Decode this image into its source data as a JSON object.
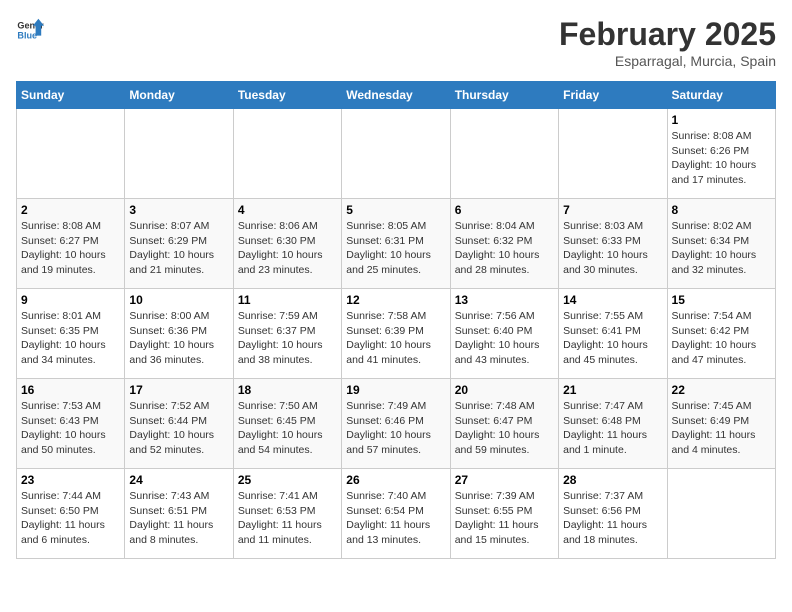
{
  "header": {
    "logo_general": "General",
    "logo_blue": "Blue",
    "title": "February 2025",
    "subtitle": "Esparragal, Murcia, Spain"
  },
  "weekdays": [
    "Sunday",
    "Monday",
    "Tuesday",
    "Wednesday",
    "Thursday",
    "Friday",
    "Saturday"
  ],
  "weeks": [
    [
      {
        "day": "",
        "content": ""
      },
      {
        "day": "",
        "content": ""
      },
      {
        "day": "",
        "content": ""
      },
      {
        "day": "",
        "content": ""
      },
      {
        "day": "",
        "content": ""
      },
      {
        "day": "",
        "content": ""
      },
      {
        "day": "1",
        "content": "Sunrise: 8:08 AM\nSunset: 6:26 PM\nDaylight: 10 hours and 17 minutes."
      }
    ],
    [
      {
        "day": "2",
        "content": "Sunrise: 8:08 AM\nSunset: 6:27 PM\nDaylight: 10 hours and 19 minutes."
      },
      {
        "day": "3",
        "content": "Sunrise: 8:07 AM\nSunset: 6:29 PM\nDaylight: 10 hours and 21 minutes."
      },
      {
        "day": "4",
        "content": "Sunrise: 8:06 AM\nSunset: 6:30 PM\nDaylight: 10 hours and 23 minutes."
      },
      {
        "day": "5",
        "content": "Sunrise: 8:05 AM\nSunset: 6:31 PM\nDaylight: 10 hours and 25 minutes."
      },
      {
        "day": "6",
        "content": "Sunrise: 8:04 AM\nSunset: 6:32 PM\nDaylight: 10 hours and 28 minutes."
      },
      {
        "day": "7",
        "content": "Sunrise: 8:03 AM\nSunset: 6:33 PM\nDaylight: 10 hours and 30 minutes."
      },
      {
        "day": "8",
        "content": "Sunrise: 8:02 AM\nSunset: 6:34 PM\nDaylight: 10 hours and 32 minutes."
      }
    ],
    [
      {
        "day": "9",
        "content": "Sunrise: 8:01 AM\nSunset: 6:35 PM\nDaylight: 10 hours and 34 minutes."
      },
      {
        "day": "10",
        "content": "Sunrise: 8:00 AM\nSunset: 6:36 PM\nDaylight: 10 hours and 36 minutes."
      },
      {
        "day": "11",
        "content": "Sunrise: 7:59 AM\nSunset: 6:37 PM\nDaylight: 10 hours and 38 minutes."
      },
      {
        "day": "12",
        "content": "Sunrise: 7:58 AM\nSunset: 6:39 PM\nDaylight: 10 hours and 41 minutes."
      },
      {
        "day": "13",
        "content": "Sunrise: 7:56 AM\nSunset: 6:40 PM\nDaylight: 10 hours and 43 minutes."
      },
      {
        "day": "14",
        "content": "Sunrise: 7:55 AM\nSunset: 6:41 PM\nDaylight: 10 hours and 45 minutes."
      },
      {
        "day": "15",
        "content": "Sunrise: 7:54 AM\nSunset: 6:42 PM\nDaylight: 10 hours and 47 minutes."
      }
    ],
    [
      {
        "day": "16",
        "content": "Sunrise: 7:53 AM\nSunset: 6:43 PM\nDaylight: 10 hours and 50 minutes."
      },
      {
        "day": "17",
        "content": "Sunrise: 7:52 AM\nSunset: 6:44 PM\nDaylight: 10 hours and 52 minutes."
      },
      {
        "day": "18",
        "content": "Sunrise: 7:50 AM\nSunset: 6:45 PM\nDaylight: 10 hours and 54 minutes."
      },
      {
        "day": "19",
        "content": "Sunrise: 7:49 AM\nSunset: 6:46 PM\nDaylight: 10 hours and 57 minutes."
      },
      {
        "day": "20",
        "content": "Sunrise: 7:48 AM\nSunset: 6:47 PM\nDaylight: 10 hours and 59 minutes."
      },
      {
        "day": "21",
        "content": "Sunrise: 7:47 AM\nSunset: 6:48 PM\nDaylight: 11 hours and 1 minute."
      },
      {
        "day": "22",
        "content": "Sunrise: 7:45 AM\nSunset: 6:49 PM\nDaylight: 11 hours and 4 minutes."
      }
    ],
    [
      {
        "day": "23",
        "content": "Sunrise: 7:44 AM\nSunset: 6:50 PM\nDaylight: 11 hours and 6 minutes."
      },
      {
        "day": "24",
        "content": "Sunrise: 7:43 AM\nSunset: 6:51 PM\nDaylight: 11 hours and 8 minutes."
      },
      {
        "day": "25",
        "content": "Sunrise: 7:41 AM\nSunset: 6:53 PM\nDaylight: 11 hours and 11 minutes."
      },
      {
        "day": "26",
        "content": "Sunrise: 7:40 AM\nSunset: 6:54 PM\nDaylight: 11 hours and 13 minutes."
      },
      {
        "day": "27",
        "content": "Sunrise: 7:39 AM\nSunset: 6:55 PM\nDaylight: 11 hours and 15 minutes."
      },
      {
        "day": "28",
        "content": "Sunrise: 7:37 AM\nSunset: 6:56 PM\nDaylight: 11 hours and 18 minutes."
      },
      {
        "day": "",
        "content": ""
      }
    ]
  ]
}
